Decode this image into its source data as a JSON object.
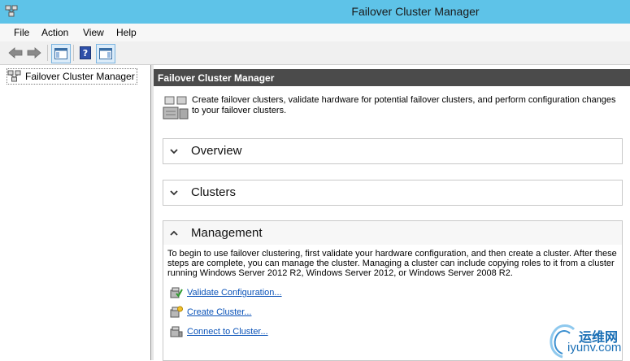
{
  "window": {
    "title": "Failover Cluster Manager"
  },
  "menu": [
    "File",
    "Action",
    "View",
    "Help"
  ],
  "toolbar": {
    "back_icon": "back-arrow-icon",
    "forward_icon": "forward-arrow-icon"
  },
  "tree": {
    "root_label": "Failover Cluster Manager"
  },
  "main": {
    "header": "Failover Cluster Manager",
    "intro": "Create failover clusters, validate hardware for potential failover clusters, and perform configuration changes to your failover clusters.",
    "sections": [
      {
        "title": "Overview",
        "expanded": false
      },
      {
        "title": "Clusters",
        "expanded": false
      },
      {
        "title": "Management",
        "expanded": true
      }
    ],
    "management": {
      "description": "To begin to use failover clustering, first validate your hardware configuration, and then create a cluster.  After these steps are complete, you can manage the cluster. Managing a cluster can include copying roles to it from a cluster running Windows Server 2012 R2, Windows Server 2012, or Windows Server 2008 R2.",
      "actions": [
        {
          "label": "Validate Configuration..."
        },
        {
          "label": "Create Cluster..."
        },
        {
          "label": "Connect to Cluster..."
        }
      ]
    }
  },
  "watermark": {
    "line1": "运维网",
    "line2": "iyunv.com"
  },
  "colors": {
    "titlebar": "#5ec3e8",
    "header": "#4b4b4b",
    "link": "#0b53b8"
  }
}
